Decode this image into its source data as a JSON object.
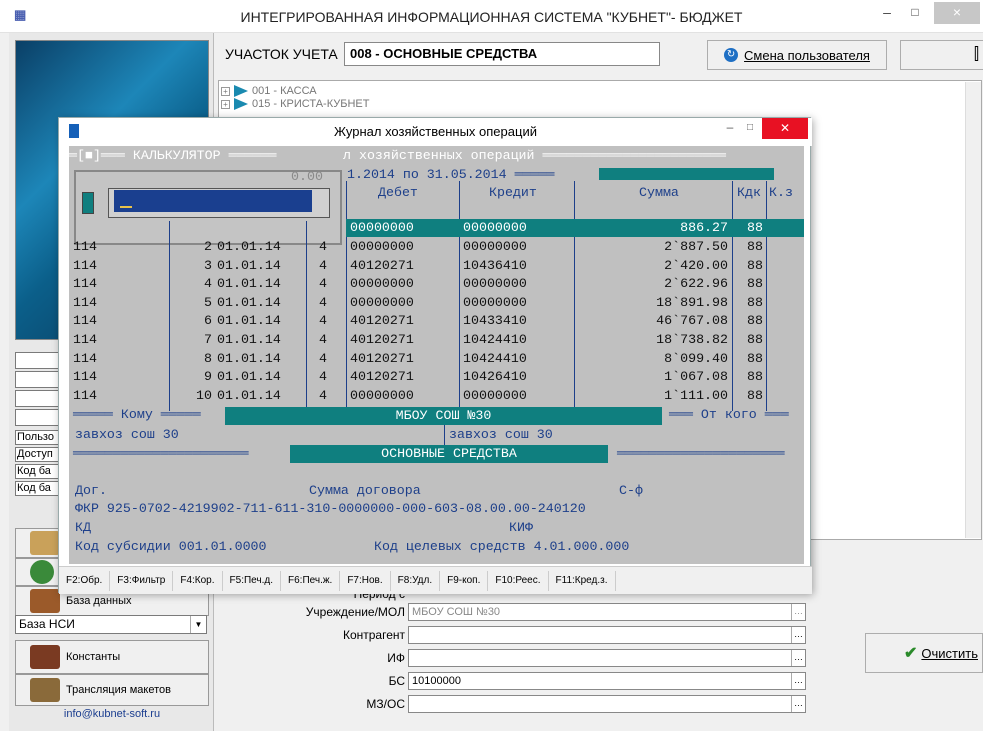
{
  "app": {
    "title": "ИНТЕГРИРОВАННАЯ ИНФОРМАЦИОННАЯ СИСТЕМА \"КУБНЕТ\"- БЮДЖЕТ",
    "logo_icon": "app-logo-icon",
    "win_min": "–",
    "win_max": "□",
    "win_close": "×"
  },
  "header": {
    "account_label": "УЧАСТОК УЧЕТА",
    "account_value": "008 - ОСНОВНЫЕ СРЕДСТВА",
    "switch_user_label": "Смена пользователя",
    "right_button_icon": "exit-door-icon"
  },
  "tree": {
    "items": [
      {
        "label": "001 - КАССА"
      },
      {
        "label": "015 - КРИСТА-КУБНЕТ"
      }
    ]
  },
  "sidebar": {
    "labels": [
      "Пользо",
      "Доступ",
      "Код ба",
      "Код ба"
    ],
    "buttons": [
      {
        "label": "",
        "icon": "scroll-icon"
      },
      {
        "label": "",
        "icon": "globe-icon"
      },
      {
        "label": "База данных",
        "icon": "database-icon"
      },
      {
        "label": "Константы",
        "icon": "constants-icon"
      },
      {
        "label": "Трансляция макетов",
        "icon": "translate-layout-icon"
      }
    ],
    "select_value": "База НСИ",
    "email": "info@kubnet-soft.ru"
  },
  "filters": {
    "period_label": "Период с",
    "fields": [
      {
        "label": "Учреждение/МОЛ",
        "value": "МБОУ СОШ №30"
      },
      {
        "label": "Контрагент",
        "value": ""
      },
      {
        "label": "ИФ",
        "value": ""
      },
      {
        "label": "БС",
        "value": "10100000"
      },
      {
        "label": "МЗ/ОС",
        "value": ""
      }
    ],
    "clear_label": "Очистить"
  },
  "dialog": {
    "title": "Журнал хозяйственных операций",
    "calc_header": "═[■]═══ КАЛЬКУЛЯТОР ══════",
    "calc_value": "0.00",
    "journal_header": "л хозяйственных операций ═══════════════════════",
    "date_range": "1.2014 по 31.05.2014 ═════",
    "columns": [
      "Дебет",
      "Кредит",
      "Сумма",
      "Кдк",
      "К.з"
    ],
    "highlight_row": {
      "debit": "00000000",
      "credit": "00000000",
      "sum": "886.27",
      "kdk": "88"
    },
    "rows": [
      {
        "a": "114",
        "n": "2",
        "date": "01.01.14",
        "k": "4",
        "debit": "00000000",
        "credit": "00000000",
        "sum": "2`887.50",
        "kdk": "88"
      },
      {
        "a": "114",
        "n": "3",
        "date": "01.01.14",
        "k": "4",
        "debit": "40120271",
        "credit": "10436410",
        "sum": "2`420.00",
        "kdk": "88"
      },
      {
        "a": "114",
        "n": "4",
        "date": "01.01.14",
        "k": "4",
        "debit": "00000000",
        "credit": "00000000",
        "sum": "2`622.96",
        "kdk": "88"
      },
      {
        "a": "114",
        "n": "5",
        "date": "01.01.14",
        "k": "4",
        "debit": "00000000",
        "credit": "00000000",
        "sum": "18`891.98",
        "kdk": "88"
      },
      {
        "a": "114",
        "n": "6",
        "date": "01.01.14",
        "k": "4",
        "debit": "40120271",
        "credit": "10433410",
        "sum": "46`767.08",
        "kdk": "88"
      },
      {
        "a": "114",
        "n": "7",
        "date": "01.01.14",
        "k": "4",
        "debit": "40120271",
        "credit": "10424410",
        "sum": "18`738.82",
        "kdk": "88"
      },
      {
        "a": "114",
        "n": "8",
        "date": "01.01.14",
        "k": "4",
        "debit": "40120271",
        "credit": "10424410",
        "sum": "8`099.40",
        "kdk": "88"
      },
      {
        "a": "114",
        "n": "9",
        "date": "01.01.14",
        "k": "4",
        "debit": "40120271",
        "credit": "10426410",
        "sum": "1`067.08",
        "kdk": "88"
      },
      {
        "a": "114",
        "n": "10",
        "date": "01.01.14",
        "k": "4",
        "debit": "00000000",
        "credit": "00000000",
        "sum": "1`111.00",
        "kdk": "88"
      }
    ],
    "to_label": "═════ Кому ═════",
    "institution": "МБОУ СОШ №30",
    "from_label": "═══ От кого ═══",
    "to_value": "завхоз сош 30",
    "from_value": "завхоз сош 30",
    "section": "ОСНОВНЫЕ СРЕДСТВА",
    "sep_left": "══════════════════════",
    "sep_right": "═════════════════════",
    "dog_label": "Дог.",
    "contract_sum_label": "Сумма договора",
    "sf_label": "С-ф",
    "fkr_line": "ФКР 925-0702-4219902-711-611-310-0000000-000-603-08.00.00-240120",
    "kd_label": "КД",
    "kif_label": "КИФ",
    "subsidy_line": "Код субсидии 001.01.0000",
    "target_line": "Код целевых средств 4.01.000.000",
    "fkeys": [
      "F2:Обр.",
      "F3:Фильтр",
      "F4:Кор.",
      "F5:Печ.д.",
      "F6:Печ.ж.",
      "F7:Нов.",
      "F8:Удл.",
      "F9-коп.",
      "F10:Реес.",
      "F11:Кред.з."
    ]
  }
}
